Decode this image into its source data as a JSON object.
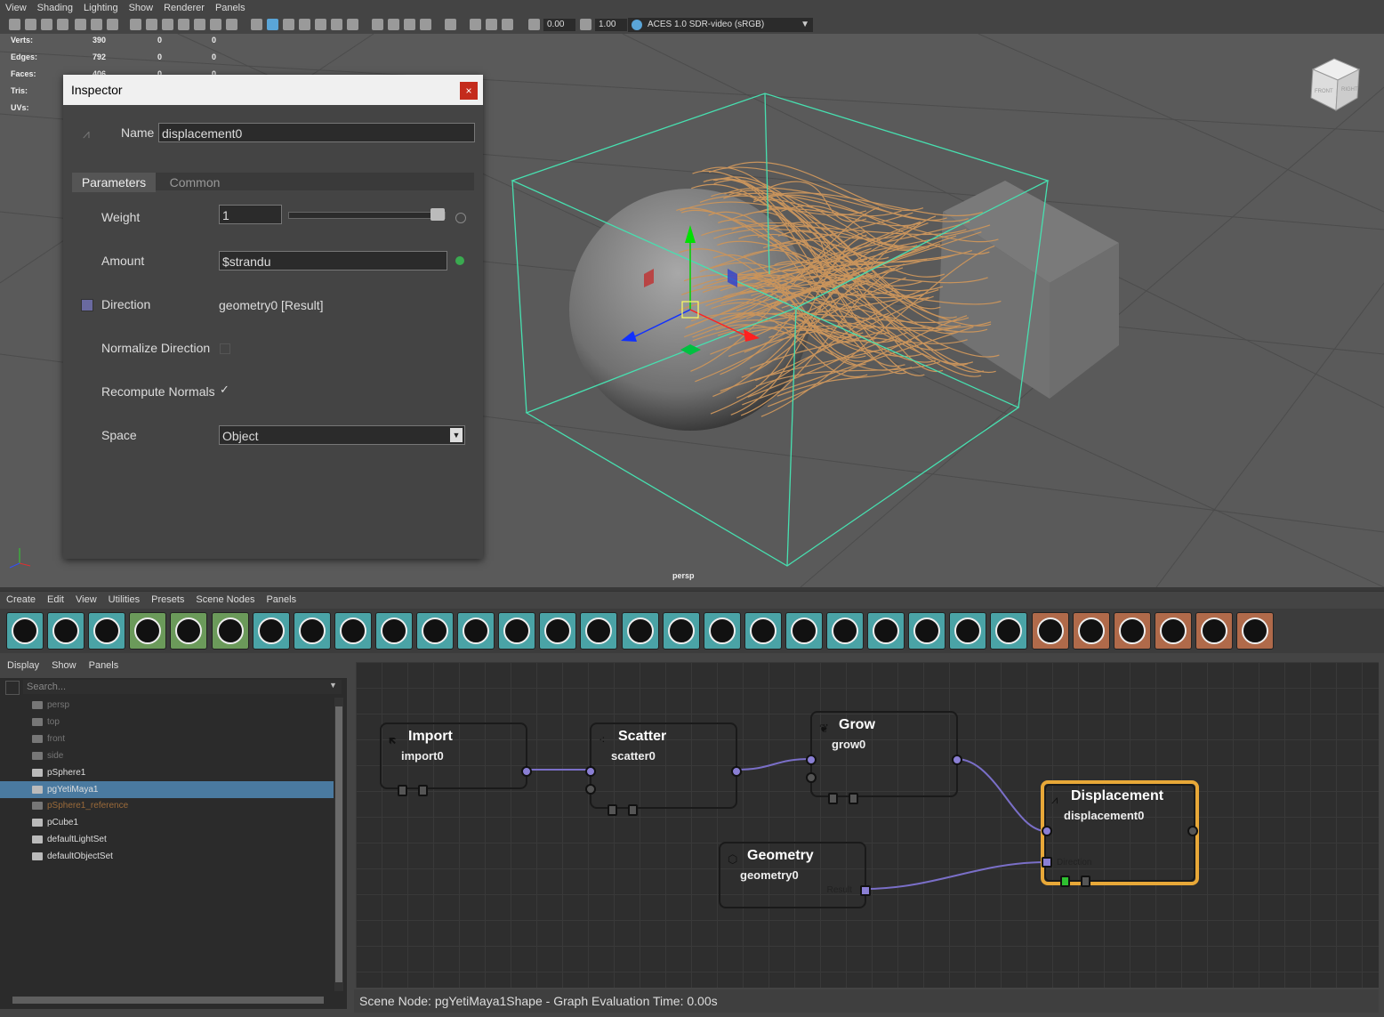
{
  "viewport": {
    "menu": [
      "View",
      "Shading",
      "Lighting",
      "Show",
      "Renderer",
      "Panels"
    ],
    "toolbar": {
      "exposure": "0.00",
      "gamma": "1.00",
      "color_space": "ACES 1.0 SDR-video (sRGB)"
    },
    "hud": [
      {
        "label": "Verts:",
        "v1": "390",
        "v2": "0",
        "v3": "0"
      },
      {
        "label": "Edges:",
        "v1": "792",
        "v2": "0",
        "v3": "0"
      },
      {
        "label": "Faces:",
        "v1": "406",
        "v2": "0",
        "v3": "0"
      },
      {
        "label": "Tris:",
        "v1": "",
        "v2": "",
        "v3": ""
      },
      {
        "label": "UVs:",
        "v1": "",
        "v2": "",
        "v3": ""
      }
    ],
    "camera_label": "persp",
    "viewcube_front": "FRONT",
    "viewcube_right": "RIGHT"
  },
  "inspector": {
    "title": "Inspector",
    "close": "×",
    "name_label": "Name",
    "name_value": "displacement0",
    "tabs": [
      "Parameters",
      "Common"
    ],
    "weight_label": "Weight",
    "weight_value": "1",
    "weight_fraction": 1.0,
    "amount_label": "Amount",
    "amount_value": "$strandu",
    "direction_label": "Direction",
    "direction_value": "geometry0 [Result]",
    "normalize_label": "Normalize Direction",
    "recompute_label": "Recompute Normals",
    "recompute_check": "✓",
    "space_label": "Space",
    "space_value": "Object"
  },
  "node_editor": {
    "menu": [
      "Create",
      "Edit",
      "View",
      "Utilities",
      "Presets",
      "Scene Nodes",
      "Panels"
    ],
    "outliner_menu": [
      "Display",
      "Show",
      "Panels"
    ],
    "search_placeholder": "Search...",
    "outliner_items": [
      {
        "label": "persp",
        "dim": true
      },
      {
        "label": "top",
        "dim": true
      },
      {
        "label": "front",
        "dim": true
      },
      {
        "label": "side",
        "dim": true
      },
      {
        "label": "pSphere1",
        "dim": false
      },
      {
        "label": "pgYetiMaya1",
        "dim": false,
        "selected": true
      },
      {
        "label": "pSphere1_reference",
        "dim": true,
        "orange": true
      },
      {
        "label": "pCube1",
        "dim": false
      },
      {
        "label": "defaultLightSet",
        "dim": false
      },
      {
        "label": "defaultObjectSet",
        "dim": false
      }
    ],
    "nodes": {
      "import": {
        "title": "Import",
        "sub": "import0",
        "color": "#3e5e86"
      },
      "scatter": {
        "title": "Scatter",
        "sub": "scatter0",
        "color": "#5a8a55"
      },
      "grow": {
        "title": "Grow",
        "sub": "grow0",
        "color": "#5a8a55"
      },
      "displacement": {
        "title": "Displacement",
        "sub": "displacement0",
        "color": "#3fa3a1",
        "port_direction": "Direction"
      },
      "geometry": {
        "title": "Geometry",
        "sub": "geometry0",
        "color": "#9a5f42",
        "port_result": "Result"
      }
    },
    "status": "Scene Node: pgYetiMaya1Shape - Graph Evaluation Time: 0.00s"
  },
  "colors": {
    "shelf_teal": "#4aa3a6",
    "shelf_green": "#6b9a5a",
    "shelf_orange": "#b06a4a",
    "selection": "#4a7aa0",
    "bbox": "#47e0b0",
    "fur": "#c9945c"
  },
  "icons": {
    "shelf": [
      "pointer-icon",
      "puzzle-icon",
      "box-icon",
      "scatter-icon",
      "leaf-icon",
      "cylinder-icon",
      "exclamation-icon",
      "clump-icon",
      "brush-icon",
      "fur-icon",
      "comb-icon",
      "curl-icon",
      "spiral-icon",
      "hand-icon",
      "displacement-icon",
      "split-icon",
      "scissors-icon",
      "arrow-up-icon",
      "clock-icon",
      "wave-icon",
      "curve-icon",
      "paint-icon",
      "random-icon",
      "move-icon",
      "filter-icon",
      "graph-icon",
      "image-icon",
      "cube-icon",
      "sun-icon",
      "grid-icon",
      "palette-icon"
    ]
  }
}
